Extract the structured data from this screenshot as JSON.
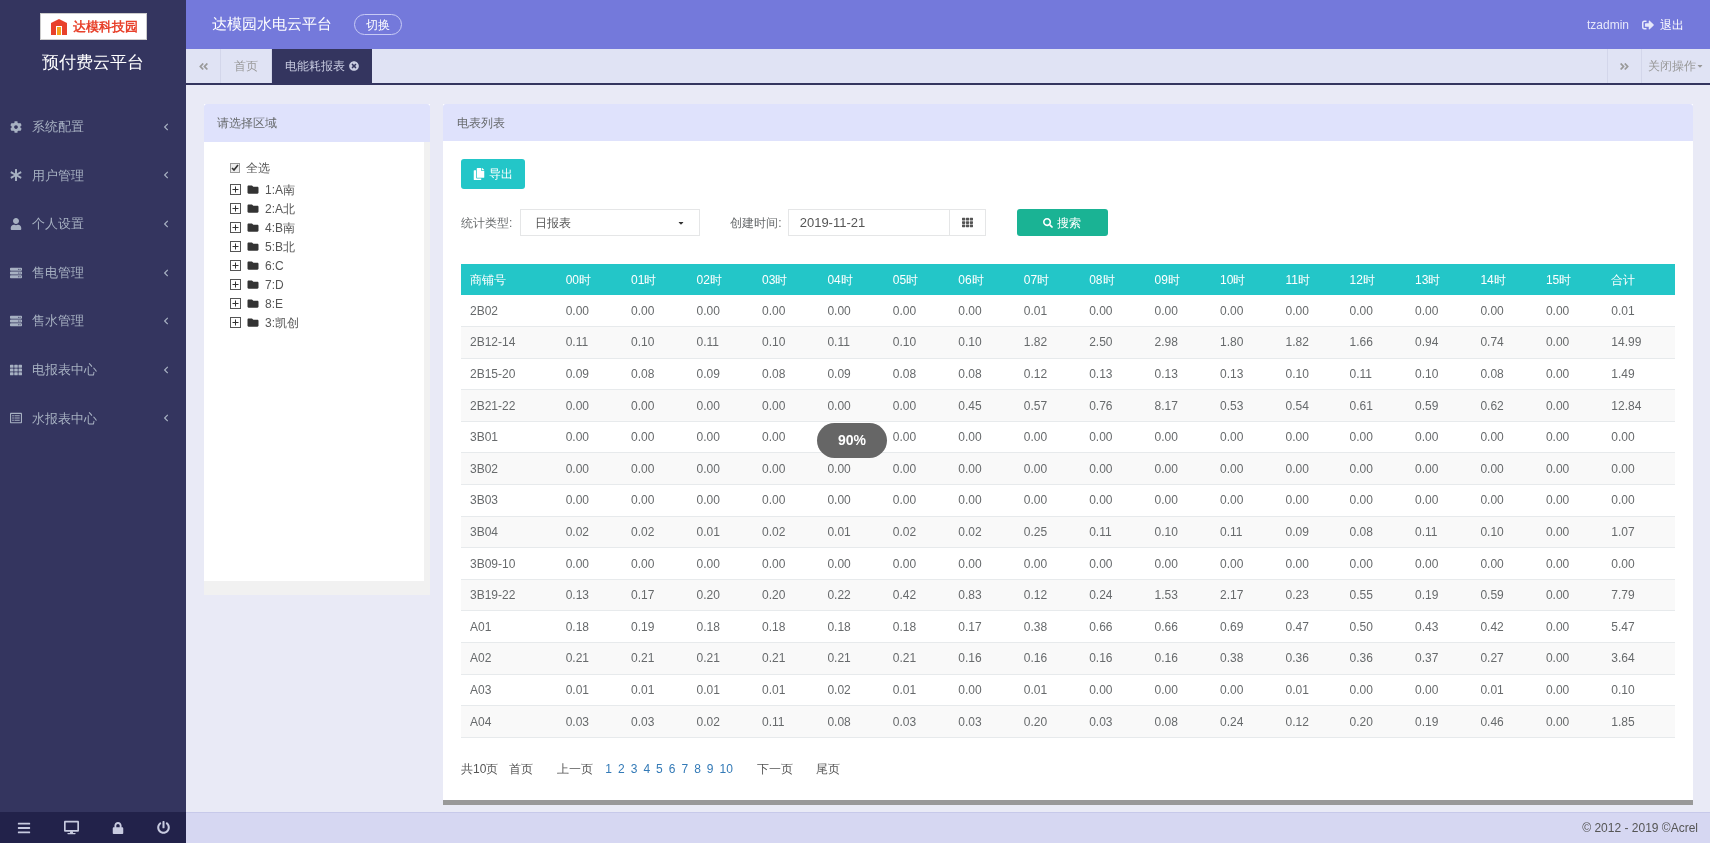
{
  "sidebar": {
    "logo_text": "达模科技园",
    "title": "预付费云平台",
    "menu": [
      {
        "label": "系统配置",
        "expanded": false
      },
      {
        "label": "用户管理",
        "expanded": false
      },
      {
        "label": "个人设置",
        "expanded": false
      },
      {
        "label": "售电管理",
        "expanded": false
      },
      {
        "label": "售水管理",
        "expanded": false
      },
      {
        "label": "电报表中心",
        "expanded": false
      },
      {
        "label": "水报表中心",
        "expanded": false
      }
    ]
  },
  "header": {
    "title": "达模园水电云平台",
    "switch_button": "切换",
    "user": "tzadmin",
    "logout": "退出"
  },
  "tabs": [
    {
      "label": "首页",
      "selected": false
    },
    {
      "label": "电能耗报表",
      "selected": true
    }
  ],
  "tab_actions": "关闭操作",
  "region_panel": {
    "title": "请选择区域",
    "select_all": {
      "label": "全选",
      "checked": true
    },
    "tree": [
      {
        "label": "1:A南",
        "expanded": false
      },
      {
        "label": "2:A北",
        "expanded": false
      },
      {
        "label": "4:B南",
        "expanded": false
      },
      {
        "label": "5:B北",
        "expanded": false
      },
      {
        "label": "6:C",
        "expanded": false
      },
      {
        "label": "7:D",
        "expanded": false
      },
      {
        "label": "8:E",
        "expanded": false
      },
      {
        "label": "3:凯创",
        "expanded": false
      }
    ]
  },
  "meter_panel": {
    "title": "电表列表",
    "export_button": "导出",
    "type_label": "统计类型:",
    "type_value": "日报表",
    "date_label": "创建时间:",
    "date_value": "2019-11-21",
    "search_button": "搜索",
    "loading_badge": "90%",
    "table": {
      "columns": [
        "商铺号",
        "00时",
        "01时",
        "02时",
        "03时",
        "04时",
        "05时",
        "06时",
        "07时",
        "08时",
        "09时",
        "10时",
        "11时",
        "12时",
        "13时",
        "14时",
        "15时",
        "合计"
      ],
      "rows": [
        {
          "cells": [
            "2B02",
            "0.00",
            "0.00",
            "0.00",
            "0.00",
            "0.00",
            "0.00",
            "0.00",
            "0.01",
            "0.00",
            "0.00",
            "0.00",
            "0.00",
            "0.00",
            "0.00",
            "0.00",
            "0.00",
            "0.01"
          ]
        },
        {
          "cells": [
            "2B12-14",
            "0.11",
            "0.10",
            "0.11",
            "0.10",
            "0.11",
            "0.10",
            "0.10",
            "1.82",
            "2.50",
            "2.98",
            "1.80",
            "1.82",
            "1.66",
            "0.94",
            "0.74",
            "0.00",
            "14.99"
          ]
        },
        {
          "cells": [
            "2B15-20",
            "0.09",
            "0.08",
            "0.09",
            "0.08",
            "0.09",
            "0.08",
            "0.08",
            "0.12",
            "0.13",
            "0.13",
            "0.13",
            "0.10",
            "0.11",
            "0.10",
            "0.08",
            "0.00",
            "1.49"
          ]
        },
        {
          "cells": [
            "2B21-22",
            "0.00",
            "0.00",
            "0.00",
            "0.00",
            "0.00",
            "0.00",
            "0.45",
            "0.57",
            "0.76",
            "8.17",
            "0.53",
            "0.54",
            "0.61",
            "0.59",
            "0.62",
            "0.00",
            "12.84"
          ]
        },
        {
          "cells": [
            "3B01",
            "0.00",
            "0.00",
            "0.00",
            "0.00",
            null,
            "0.00",
            "0.00",
            "0.00",
            "0.00",
            "0.00",
            "0.00",
            "0.00",
            "0.00",
            "0.00",
            "0.00",
            "0.00",
            "0.00"
          ]
        },
        {
          "cells": [
            "3B02",
            "0.00",
            "0.00",
            "0.00",
            "0.00",
            "0.00",
            "0.00",
            "0.00",
            "0.00",
            "0.00",
            "0.00",
            "0.00",
            "0.00",
            "0.00",
            "0.00",
            "0.00",
            "0.00",
            "0.00"
          ]
        },
        {
          "cells": [
            "3B03",
            "0.00",
            "0.00",
            "0.00",
            "0.00",
            "0.00",
            "0.00",
            "0.00",
            "0.00",
            "0.00",
            "0.00",
            "0.00",
            "0.00",
            "0.00",
            "0.00",
            "0.00",
            "0.00",
            "0.00"
          ]
        },
        {
          "cells": [
            "3B04",
            "0.02",
            "0.02",
            "0.01",
            "0.02",
            "0.01",
            "0.02",
            "0.02",
            "0.25",
            "0.11",
            "0.10",
            "0.11",
            "0.09",
            "0.08",
            "0.11",
            "0.10",
            "0.00",
            "1.07"
          ]
        },
        {
          "cells": [
            "3B09-10",
            "0.00",
            "0.00",
            "0.00",
            "0.00",
            "0.00",
            "0.00",
            "0.00",
            "0.00",
            "0.00",
            "0.00",
            "0.00",
            "0.00",
            "0.00",
            "0.00",
            "0.00",
            "0.00",
            "0.00"
          ]
        },
        {
          "cells": [
            "3B19-22",
            "0.13",
            "0.17",
            "0.20",
            "0.20",
            "0.22",
            "0.42",
            "0.83",
            "0.12",
            "0.24",
            "1.53",
            "2.17",
            "0.23",
            "0.55",
            "0.19",
            "0.59",
            "0.00",
            "7.79"
          ]
        },
        {
          "cells": [
            "A01",
            "0.18",
            "0.19",
            "0.18",
            "0.18",
            "0.18",
            "0.18",
            "0.17",
            "0.38",
            "0.66",
            "0.66",
            "0.69",
            "0.47",
            "0.50",
            "0.43",
            "0.42",
            "0.00",
            "5.47"
          ]
        },
        {
          "cells": [
            "A02",
            "0.21",
            "0.21",
            "0.21",
            "0.21",
            "0.21",
            "0.21",
            "0.16",
            "0.16",
            "0.16",
            "0.16",
            "0.38",
            "0.36",
            "0.36",
            "0.37",
            "0.27",
            "0.00",
            "3.64"
          ]
        },
        {
          "cells": [
            "A03",
            "0.01",
            "0.01",
            "0.01",
            "0.01",
            "0.02",
            "0.01",
            "0.00",
            "0.01",
            "0.00",
            "0.00",
            "0.00",
            "0.01",
            "0.00",
            "0.00",
            "0.01",
            "0.00",
            "0.10"
          ]
        },
        {
          "cells": [
            "A04",
            "0.03",
            "0.03",
            "0.02",
            "0.11",
            "0.08",
            "0.03",
            "0.03",
            "0.20",
            "0.03",
            "0.08",
            "0.24",
            "0.12",
            "0.20",
            "0.19",
            "0.46",
            "0.00",
            "1.85"
          ]
        }
      ]
    },
    "pagination": {
      "total": "共10页",
      "first": "首页",
      "prev": "上一页",
      "pages": [
        "1",
        "2",
        "3",
        "4",
        "5",
        "6",
        "7",
        "8",
        "9",
        "10"
      ],
      "next": "下一页",
      "last": "尾页"
    }
  },
  "footer": "© 2012 - 2019 ©Acrel"
}
